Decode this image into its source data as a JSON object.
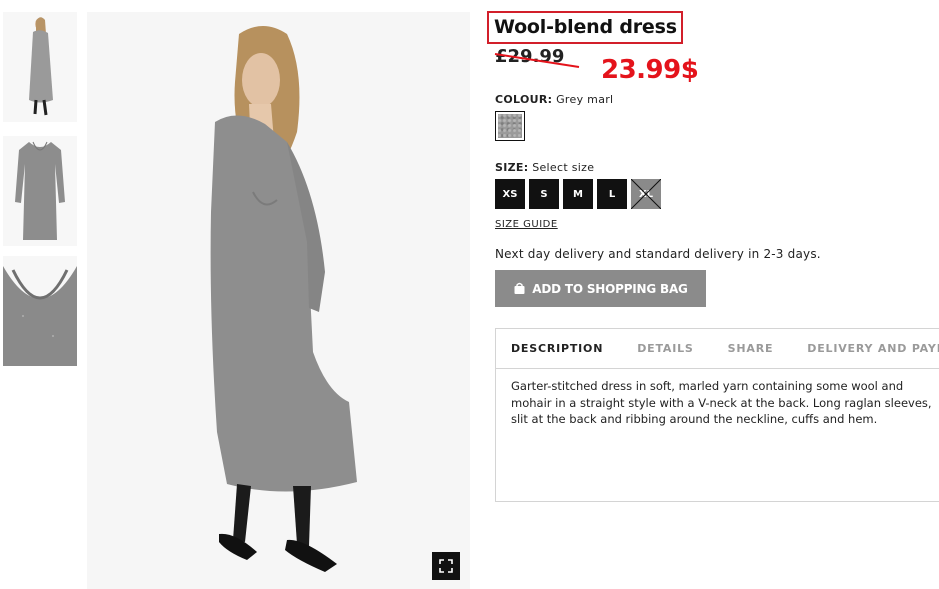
{
  "product": {
    "title": "Wool-blend dress",
    "old_price": "£29.99",
    "new_price": "23.99$"
  },
  "colour": {
    "label": "COLOUR:",
    "value": "Grey marl"
  },
  "size": {
    "label": "SIZE:",
    "value": "Select size",
    "options": [
      "XS",
      "S",
      "M",
      "L",
      "XL"
    ],
    "unavailable": [
      "XL"
    ]
  },
  "size_guide": "SIZE GUIDE",
  "delivery_text": "Next day delivery and standard delivery in 2-3 days.",
  "add_to_bag": "ADD TO SHOPPING BAG",
  "tabs": [
    "DESCRIPTION",
    "DETAILS",
    "SHARE",
    "DELIVERY AND PAYMENT"
  ],
  "active_tab": "DESCRIPTION",
  "description": "Garter-stitched dress in soft, marled yarn containing some wool and mohair in a straight style with a V-neck at the back. Long raglan sleeves, slit at the back and ribbing around the neckline, cuffs and hem.",
  "colors": {
    "annotation_red": "#e4131b",
    "button_gray": "#8b8b8b",
    "size_black": "#111111"
  },
  "icons": [
    "zoom-expand-icon",
    "shopping-bag-icon"
  ]
}
